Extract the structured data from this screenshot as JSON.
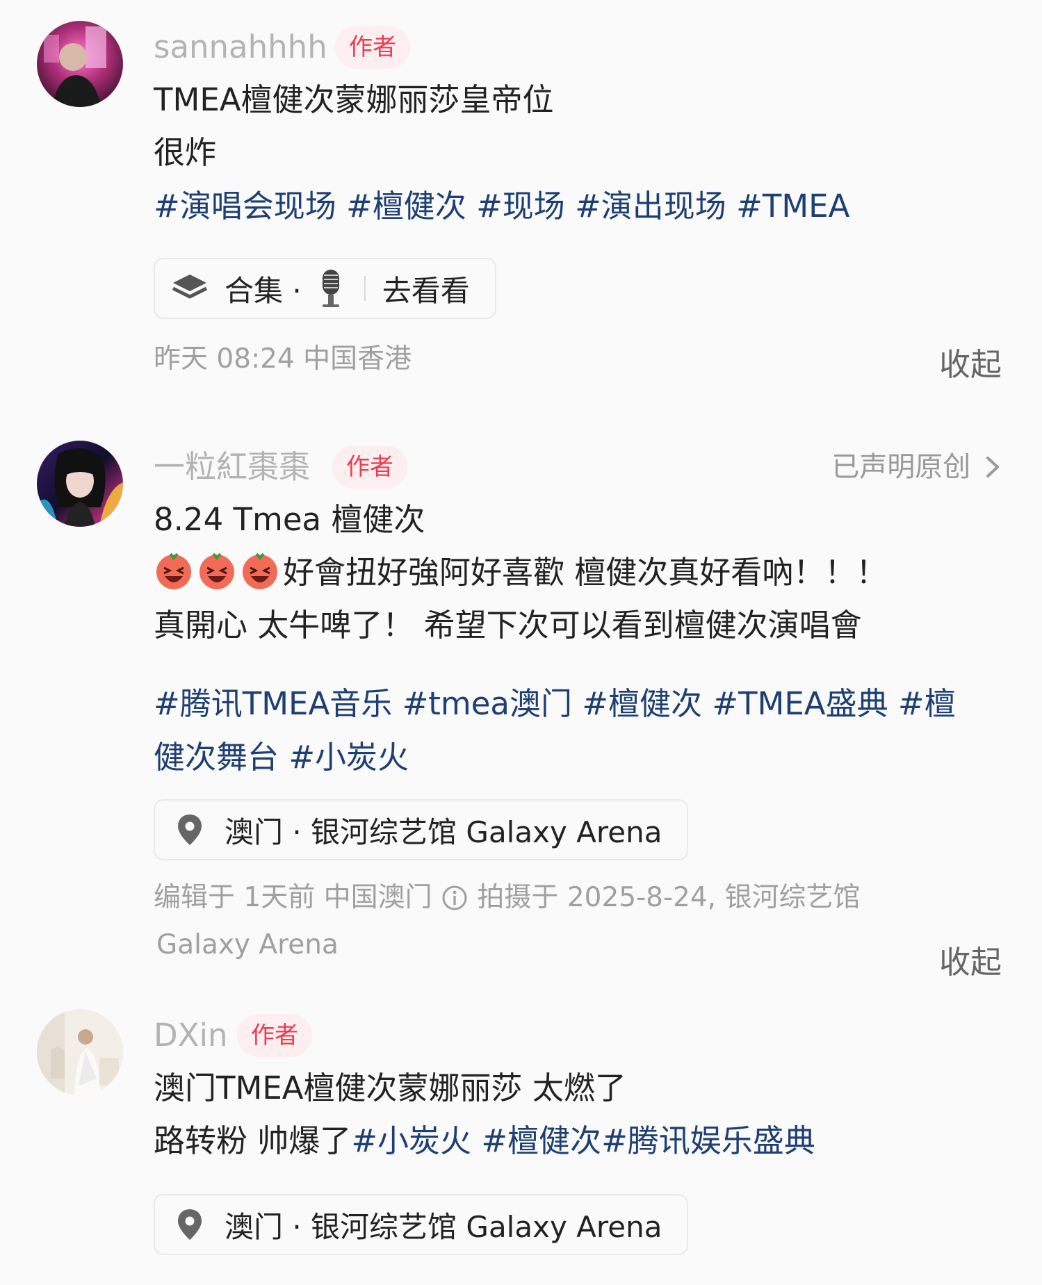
{
  "posts": [
    {
      "username": "sannahhhh",
      "badge": "作者",
      "lines": [
        "TMEA檀健次蒙娜丽莎皇帝位",
        "很炸"
      ],
      "tags": [
        "#演唱会现场",
        "#檀健次",
        "#现场",
        "#演出现场",
        "#TMEA"
      ],
      "collection": {
        "icon": "layers-icon",
        "label": "合集 ·",
        "item_icon": "microphone-icon",
        "action": "去看看"
      },
      "meta": "昨天 08:24 中国香港",
      "collapse_label": "收起"
    },
    {
      "username": "一粒紅棗棗",
      "badge": "作者",
      "original_label": "已声明原创",
      "lines": [
        "8.24 Tmea 檀健次",
        "好會扭好強阿好喜歡 檀健次真好看吶！！！",
        "真開心 太牛啤了！  希望下次可以看到檀健次演唱會"
      ],
      "emoji_icon": "laughing-emoji-icon",
      "tags_line1": [
        "#腾讯TMEA音乐",
        "#tmea澳门",
        "#檀健次",
        "#TMEA盛典",
        "#檀"
      ],
      "tags_line2": [
        "健次舞台",
        "#小炭火"
      ],
      "location": {
        "icon": "location-pin-icon",
        "label": "澳门 · 银河综艺馆 Galaxy Arena"
      },
      "meta_line1": "编辑于  1天前  中国澳门",
      "meta_info_icon": "info-icon",
      "meta_line1_rest": "拍摄于 2025-8-24, 银河综艺馆",
      "meta_line2": "Galaxy Arena",
      "collapse_label": "收起"
    },
    {
      "username": "DXin",
      "badge": "作者",
      "lines": [
        "澳门TMEA檀健次蒙娜丽莎 太燃了"
      ],
      "line2_text": "路转粉 帅爆了",
      "line2_tags": [
        "#小炭火",
        "#檀健次",
        "#腾讯娱乐盛典"
      ],
      "location": {
        "icon": "location-pin-icon",
        "label": "澳门 · 银河综艺馆 Galaxy Arena"
      }
    }
  ],
  "colors": {
    "background": "#fafafa",
    "username": "#b3b3b3",
    "badge_text": "#f03a50",
    "badge_bg": "#fdeef0",
    "tag": "#1d3f72",
    "meta": "#a0a0a0"
  }
}
